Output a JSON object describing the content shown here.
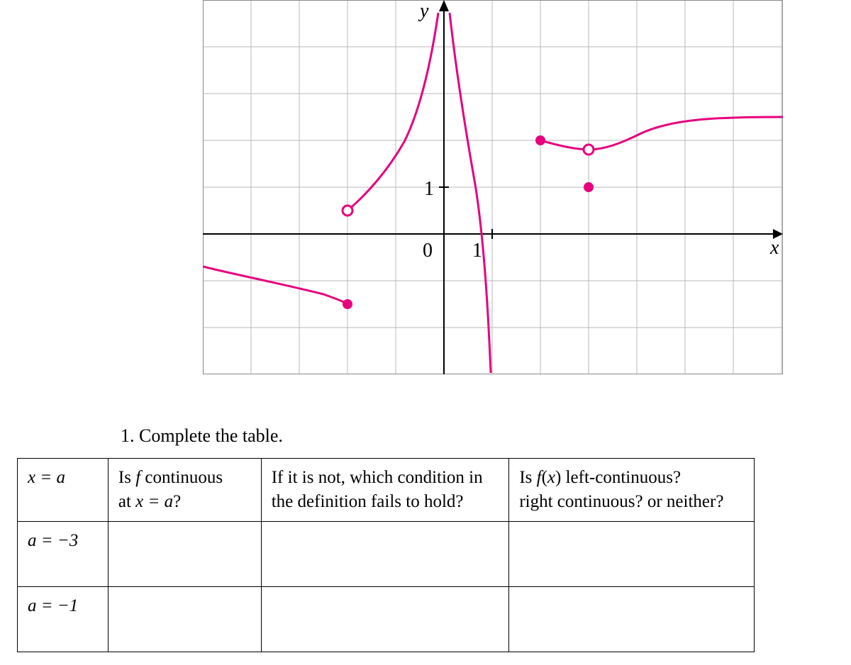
{
  "prompt": "1. Complete the table.",
  "yAxisLabel": "y",
  "xAxisLabel": "x",
  "tickLabel1y": "1",
  "tickLabel0": "0",
  "tickLabel1x": "1",
  "table": {
    "head": {
      "c1": "x = a",
      "c2a": "Is ",
      "c2b": "f",
      "c2c": " continuous",
      "c2d": "at ",
      "c2e": "x = a",
      "c2f": "?",
      "c3a": "If it is not, which condition in",
      "c3b": "the definition fails to hold?",
      "c4a": "Is ",
      "c4b": "f",
      "c4c": "(",
      "c4d": "x",
      "c4e": ") left-continuous?",
      "c4f": "right continuous? or neither?"
    },
    "rows": [
      {
        "label": "a = −3"
      },
      {
        "label": "a = −1"
      }
    ]
  },
  "chart_data": {
    "type": "line",
    "title": "",
    "xlabel": "x",
    "ylabel": "y",
    "xlim": [
      -5,
      7
    ],
    "ylim": [
      -3,
      5
    ],
    "grid": true,
    "series": [
      {
        "name": "piece1",
        "description": "Left branch, defined on (-5,-2), approaching y≈-0.7 at x=-5 and descending to a filled endpoint at (-2,-1.5)",
        "points": [
          [
            -5,
            -0.7
          ],
          [
            -4,
            -0.9
          ],
          [
            -3,
            -1.15
          ],
          [
            -2,
            -1.5
          ]
        ],
        "endpoints": {
          "right": {
            "x": -2,
            "y": -1.5,
            "filled": true
          }
        }
      },
      {
        "name": "piece2",
        "description": "Middle branch starting with an open circle at (-2,0.5), rising steeply and going to +infinity as x→0−",
        "points": [
          [
            -2,
            0.5
          ],
          [
            -1.5,
            1.0
          ],
          [
            -1,
            1.6
          ],
          [
            -0.5,
            2.8
          ],
          [
            -0.2,
            4.2
          ],
          [
            -0.05,
            5
          ]
        ],
        "endpoints": {
          "left": {
            "x": -2,
            "y": 0.5,
            "filled": false
          }
        }
      },
      {
        "name": "piece3",
        "description": "Branch coming down from +infinity just right of x=0, passing (0.5,3), going to -infinity as x→1−",
        "points": [
          [
            0.05,
            5
          ],
          [
            0.3,
            3.5
          ],
          [
            0.6,
            1.5
          ],
          [
            0.8,
            -0.5
          ],
          [
            0.95,
            -3
          ]
        ]
      },
      {
        "name": "piece4",
        "description": "Right branch starting with a filled point at (2,2), dipping to an open circle at (3,1.8), with a separate filled point at (3,1), then rising and leveling off near y≈2.5 for large x",
        "points": [
          [
            2,
            2.0
          ],
          [
            2.5,
            1.85
          ],
          [
            3,
            1.8
          ],
          [
            3.5,
            1.95
          ],
          [
            4,
            2.15
          ],
          [
            5,
            2.35
          ],
          [
            6,
            2.45
          ],
          [
            7,
            2.5
          ]
        ],
        "endpoints": {
          "left": {
            "x": 2,
            "y": 2.0,
            "filled": true
          },
          "holeAt": {
            "x": 3,
            "y": 1.8,
            "filled": false
          },
          "isolated": {
            "x": 3,
            "y": 1.0,
            "filled": true
          }
        }
      }
    ]
  }
}
